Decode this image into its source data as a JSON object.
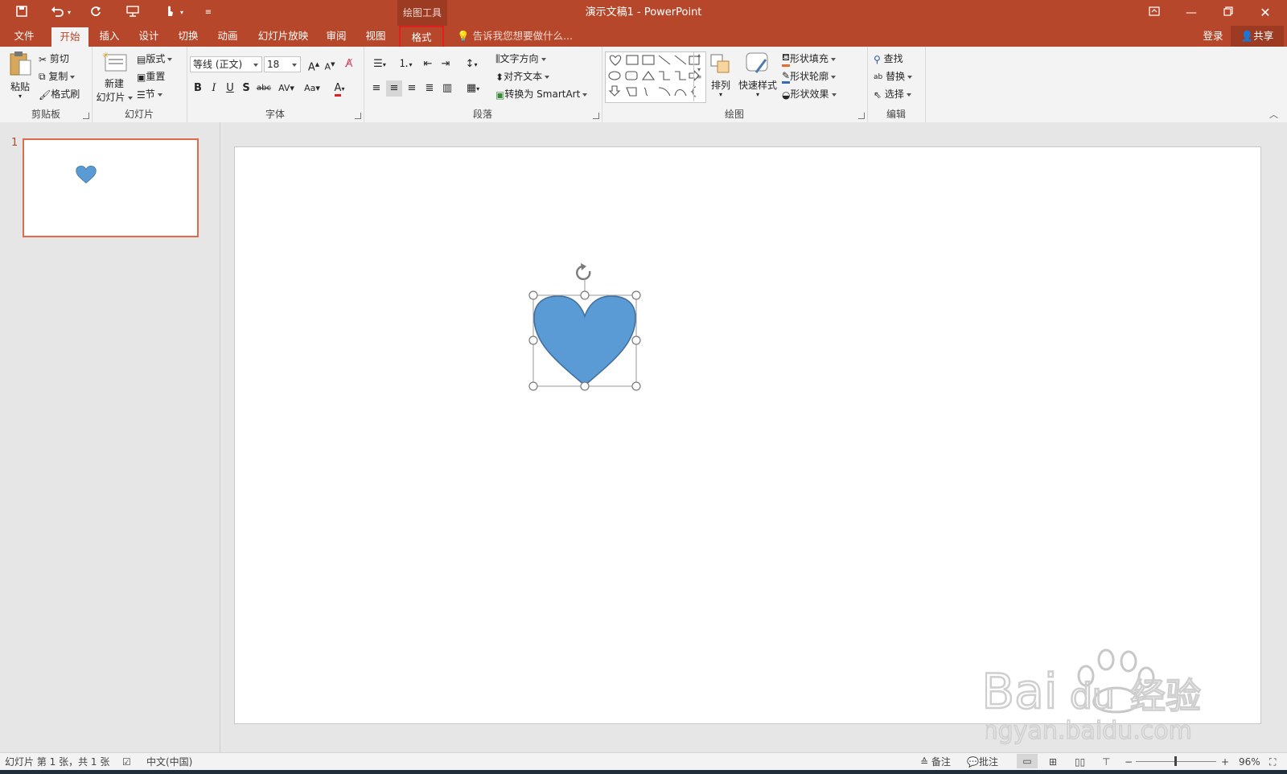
{
  "window": {
    "title": "演示文稿1 - PowerPoint",
    "context_tab_group": "绘图工具"
  },
  "quick_access": {
    "save": "save-icon",
    "undo": "undo-icon",
    "redo": "redo-icon",
    "present": "present-icon",
    "touch": "touch-icon",
    "customize": "customize-icon"
  },
  "account": {
    "sign_in": "登录",
    "share": "共享"
  },
  "tabs": [
    {
      "label": "文件"
    },
    {
      "label": "开始"
    },
    {
      "label": "插入"
    },
    {
      "label": "设计"
    },
    {
      "label": "切换"
    },
    {
      "label": "动画"
    },
    {
      "label": "幻灯片放映"
    },
    {
      "label": "审阅"
    },
    {
      "label": "视图"
    },
    {
      "label": "格式"
    }
  ],
  "tell_me": "告诉我您想要做什么...",
  "ribbon": {
    "clipboard": {
      "label": "剪贴板",
      "paste": "粘贴",
      "cut": "剪切",
      "copy": "复制",
      "format_painter": "格式刷"
    },
    "slides": {
      "label": "幻灯片",
      "new_slide_line1": "新建",
      "new_slide_line2": "幻灯片",
      "layout": "版式",
      "reset": "重置",
      "section": "节"
    },
    "font": {
      "label": "字体",
      "font_name": "等线 (正文)",
      "font_size": "18"
    },
    "paragraph": {
      "label": "段落",
      "text_direction": "文字方向",
      "align_text": "对齐文本",
      "smartart": "转换为 SmartArt"
    },
    "drawing": {
      "label": "绘图",
      "arrange": "排列",
      "quick_styles": "快速样式",
      "shape_fill": "形状填充",
      "shape_outline": "形状轮廓",
      "shape_effects": "形状效果"
    },
    "editing": {
      "label": "编辑",
      "find": "查找",
      "replace": "替换",
      "select": "选择"
    }
  },
  "thumbnails": [
    {
      "number": "1"
    }
  ],
  "slide": {
    "shape": "heart",
    "shape_fill": "#5b9bd5",
    "shape_outline": "#41719c"
  },
  "status": {
    "slide_info": "幻灯片 第 1 张，共 1 张",
    "language": "中文(中国)",
    "notes": "备注",
    "comments": "批注",
    "zoom": "96%"
  },
  "colors": {
    "accent": "#b7472a",
    "selected_tab_outline": "#e02020",
    "font_color_bar": "#e02020"
  },
  "watermark": {
    "brand": "Baidu经验",
    "url": "jingyan.baidu.com"
  }
}
